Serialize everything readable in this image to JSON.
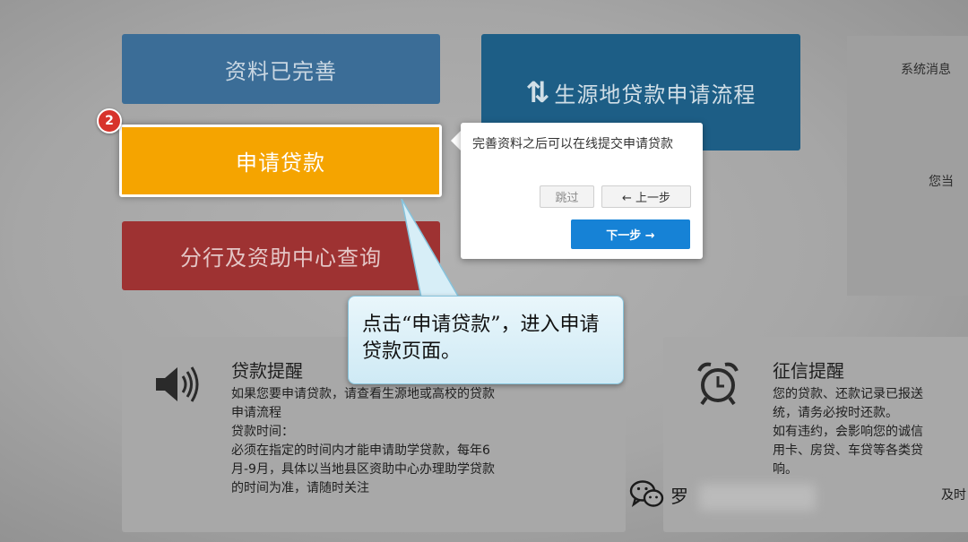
{
  "tiles": {
    "profile": "资料已完善",
    "loan": "申请贷款",
    "branch": "分行及资助中心查询",
    "process": "生源地贷款申请流程"
  },
  "step_badge": "2",
  "side": {
    "title": "系统消息",
    "note": "您当"
  },
  "popover": {
    "text": "完善资料之后可以在线提交申请贷款",
    "skip": "跳过",
    "prev": "← 上一步",
    "next": "下一步 →"
  },
  "callout": {
    "text": "点击“申请贷款”，进入申请贷款页面。"
  },
  "loan_reminder": {
    "title": "贷款提醒",
    "lines": [
      "如果您要申请贷款，请查看生源地或高校的贷款",
      "申请流程",
      "贷款时间：",
      "必须在指定的时间内才能申请助学贷款，每年6",
      "月-9月，具体以当地县区资助中心办理助学贷款",
      "的时间为准，请随时关注"
    ]
  },
  "credit_reminder": {
    "title": "征信提醒",
    "lines": [
      "您的贷款、还款记录已报送",
      "统，请务必按时还款。",
      "如有违约，会影响您的诚信",
      "用卡、房贷、车贷等各类贷",
      "响。"
    ],
    "extra": "及时"
  },
  "watermark": {
    "text": "罗"
  },
  "icons": {
    "speaker": "speaker-icon",
    "alarm": "alarm-clock-icon",
    "refresh": "refresh-icon",
    "wechat": "wechat-icon"
  },
  "colors": {
    "profile_tile": "#3b6d97",
    "loan_tile": "#f5a400",
    "branch_tile": "#9e3232",
    "process_tile": "#1d5e86",
    "next_button": "#1682d6",
    "badge": "#d7332b"
  }
}
